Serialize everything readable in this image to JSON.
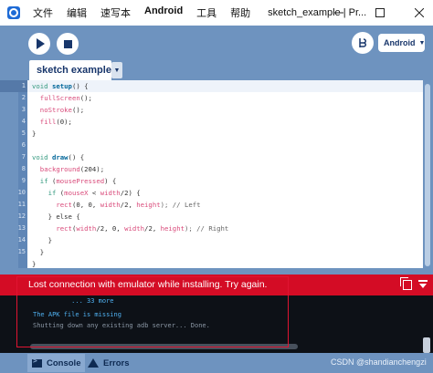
{
  "window": {
    "title": "sketch_example | Pr...",
    "menu": [
      "文件",
      "编辑",
      "速写本",
      "Android",
      "工具",
      "帮助"
    ],
    "controls": [
      "minimize-icon",
      "maximize-icon",
      "close-icon"
    ]
  },
  "toolbar": {
    "run_icon": "play-icon",
    "stop_icon": "stop-icon",
    "mode_icon": "android-mode-icon",
    "mode_label": "Android"
  },
  "editor": {
    "tab_label": "sketch example",
    "tab_menu_glyph": "▼",
    "line_numbers": [
      "1",
      "2",
      "3",
      "4",
      "5",
      "6",
      "7",
      "8",
      "9",
      "10",
      "11",
      "12",
      "13",
      "14",
      "15"
    ],
    "current_line": "1"
  },
  "code": {
    "l1": [
      "void ",
      "setup",
      "() {"
    ],
    "l2": [
      "  ",
      "fullScreen",
      "();"
    ],
    "l3": [
      "  ",
      "noStroke",
      "();"
    ],
    "l4": [
      "  ",
      "fill",
      "(0);"
    ],
    "l5": "}",
    "l7": [
      "void ",
      "draw",
      "() {"
    ],
    "l8": [
      "  ",
      "background",
      "(204);"
    ],
    "l9": [
      "  ",
      "if",
      " (",
      "mousePressed",
      ") {"
    ],
    "l10": [
      "    ",
      "if",
      " (",
      "mouseX",
      " < ",
      "width",
      "/2) {"
    ],
    "l11": [
      "      ",
      "rect",
      "(0, 0, ",
      "width",
      "/2, ",
      "height",
      "); // Left"
    ],
    "l12": "    } else {",
    "l13": [
      "      ",
      "rect",
      "(",
      "width",
      "/2, 0, ",
      "width",
      "/2, ",
      "height",
      "); // Right"
    ],
    "l14": "    }",
    "l15": "  }",
    "l16": "}"
  },
  "error": {
    "message": "Lost connection with emulator while installing. Try again.",
    "copy_icon": "copy-icon",
    "collapse_icon": "collapse-icon"
  },
  "console": {
    "lines": [
      "          ... 33 more",
      "The APK file is missing",
      "Shutting down any existing adb server... Done."
    ]
  },
  "bottom": {
    "console_tab": "Console",
    "errors_tab": "Errors",
    "watermark": "CSDN @shandianchengzi"
  },
  "colors": {
    "chrome": "#6e93bf",
    "error": "#d40c25",
    "console_bg": "#0d1117",
    "keyword": "#33997e",
    "function": "#006699",
    "builtin": "#d94a7a"
  }
}
